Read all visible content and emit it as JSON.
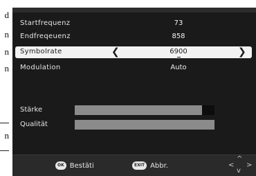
{
  "page_edge": {
    "lines": [
      "d",
      "n",
      "n",
      "n",
      "-",
      "n",
      "-"
    ]
  },
  "menu": {
    "rows": [
      {
        "label": "Startfrequenz",
        "value": "73"
      },
      {
        "label": "Endfreqeuenz",
        "value": "858"
      },
      {
        "label": "Symbolrate",
        "value": "6900",
        "left_arrow": "❮",
        "right_arrow": "❯"
      },
      {
        "label": "Modulation",
        "value": "Auto"
      }
    ],
    "selected_index": 2
  },
  "signal": {
    "strength": {
      "label": "Stärke",
      "level_percent": 91
    },
    "quality": {
      "label": "Qualität",
      "level_percent": 100
    }
  },
  "footer": {
    "ok": {
      "badge": "OK",
      "label": "Bestäti"
    },
    "exit": {
      "badge": "EXIT",
      "label": "Abbr."
    },
    "nav_icon": "four-way-navigation-icon"
  },
  "colors": {
    "screen_bg": "#1a1a1a",
    "highlight": "#f2f2f2",
    "meter_fill": "#8b8b8b"
  }
}
